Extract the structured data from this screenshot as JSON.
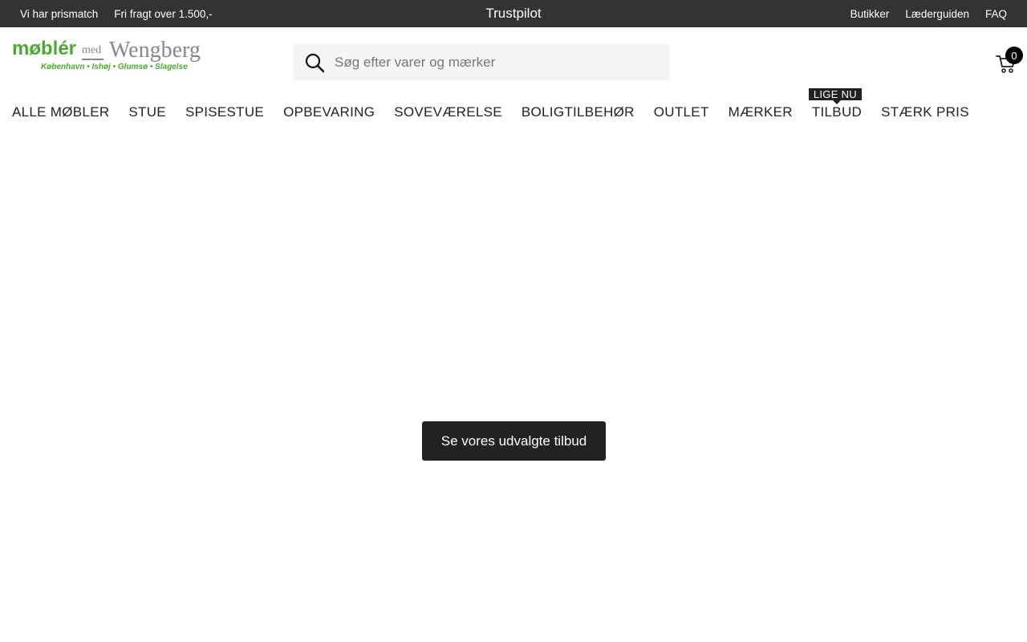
{
  "topbar": {
    "left_links": [
      "Vi har prismatch",
      "Fri fragt over 1.500,-"
    ],
    "center": "Trustpilot",
    "right_links": [
      "Butikker",
      "Læderguiden",
      "FAQ"
    ]
  },
  "logo": {
    "brand": "møblér",
    "med": "med",
    "name": "Wengberg",
    "sub": "København • Ishøj • Glumsø • Slagelse",
    "brand_color": "#4aaa2f"
  },
  "search": {
    "placeholder": "Søg efter varer og mærker",
    "value": ""
  },
  "cart": {
    "count": "0"
  },
  "nav": {
    "items": [
      "ALLE MØBLER",
      "STUE",
      "SPISESTUE",
      "OPBEVARING",
      "SOVEVÆRELSE",
      "BOLIGTILBEHØR",
      "OUTLET",
      "MÆRKER",
      "TILBUD",
      "STÆRK PRIS"
    ],
    "tilbud_tag": "LIGE NU"
  },
  "cta": {
    "label": "Se vores udvalgte tilbud"
  }
}
